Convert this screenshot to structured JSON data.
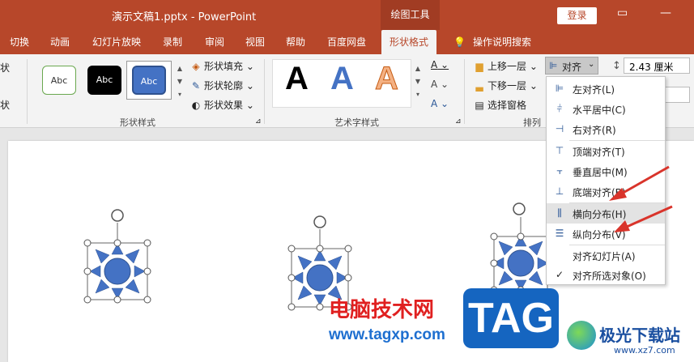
{
  "titlebar": {
    "doc_title": "演示文稿1.pptx  -  PowerPoint",
    "contextual_group": "绘图工具",
    "login": "登录"
  },
  "tabs": [
    "切换",
    "动画",
    "幻灯片放映",
    "录制",
    "审阅",
    "视图",
    "帮助",
    "百度网盘",
    "形状格式",
    "操作说明搜索"
  ],
  "ribbon": {
    "shape_styles": {
      "label": "形状样式",
      "gallery": [
        "Abc",
        "Abc",
        "Abc"
      ],
      "fill": "形状填充",
      "outline": "形状轮廓",
      "effects": "形状效果"
    },
    "wordart_styles": {
      "label": "艺术字样式",
      "samples": [
        "A",
        "A",
        "A"
      ],
      "text_fill": "A",
      "text_outline": "A",
      "text_effects": "A"
    },
    "arrange": {
      "label": "排列",
      "bring_forward": "上移一层",
      "send_backward": "下移一层",
      "selection_pane": "选择窗格",
      "align": "对齐"
    },
    "size": {
      "height": "2.43 厘米"
    },
    "left_fragments": [
      "状",
      "状"
    ]
  },
  "align_menu": {
    "items": [
      {
        "icon": "align-left-icon",
        "label": "左对齐(L)"
      },
      {
        "icon": "align-center-icon",
        "label": "水平居中(C)"
      },
      {
        "icon": "align-right-icon",
        "label": "右对齐(R)"
      },
      {
        "icon": "align-top-icon",
        "label": "顶端对齐(T)"
      },
      {
        "icon": "align-middle-icon",
        "label": "垂直居中(M)"
      },
      {
        "icon": "align-bottom-icon",
        "label": "底端对齐(B)"
      },
      {
        "icon": "distribute-horizontal-icon",
        "label": "横向分布(H)"
      },
      {
        "icon": "distribute-vertical-icon",
        "label": "纵向分布(V)"
      },
      {
        "icon": "",
        "label": "对齐幻灯片(A)"
      },
      {
        "icon": "check-icon",
        "label": "对齐所选对象(O)"
      }
    ],
    "checkmark": "✓"
  },
  "watermark": {
    "cn": "电脑技术网",
    "url": "www.tagxp.com",
    "tag": "TAG",
    "site": "极光下载站",
    "site_url": "www.xz7.com"
  },
  "colors": {
    "accent": "#b7472a",
    "shape_fill": "#4472c4",
    "arrow": "#d9342b"
  }
}
